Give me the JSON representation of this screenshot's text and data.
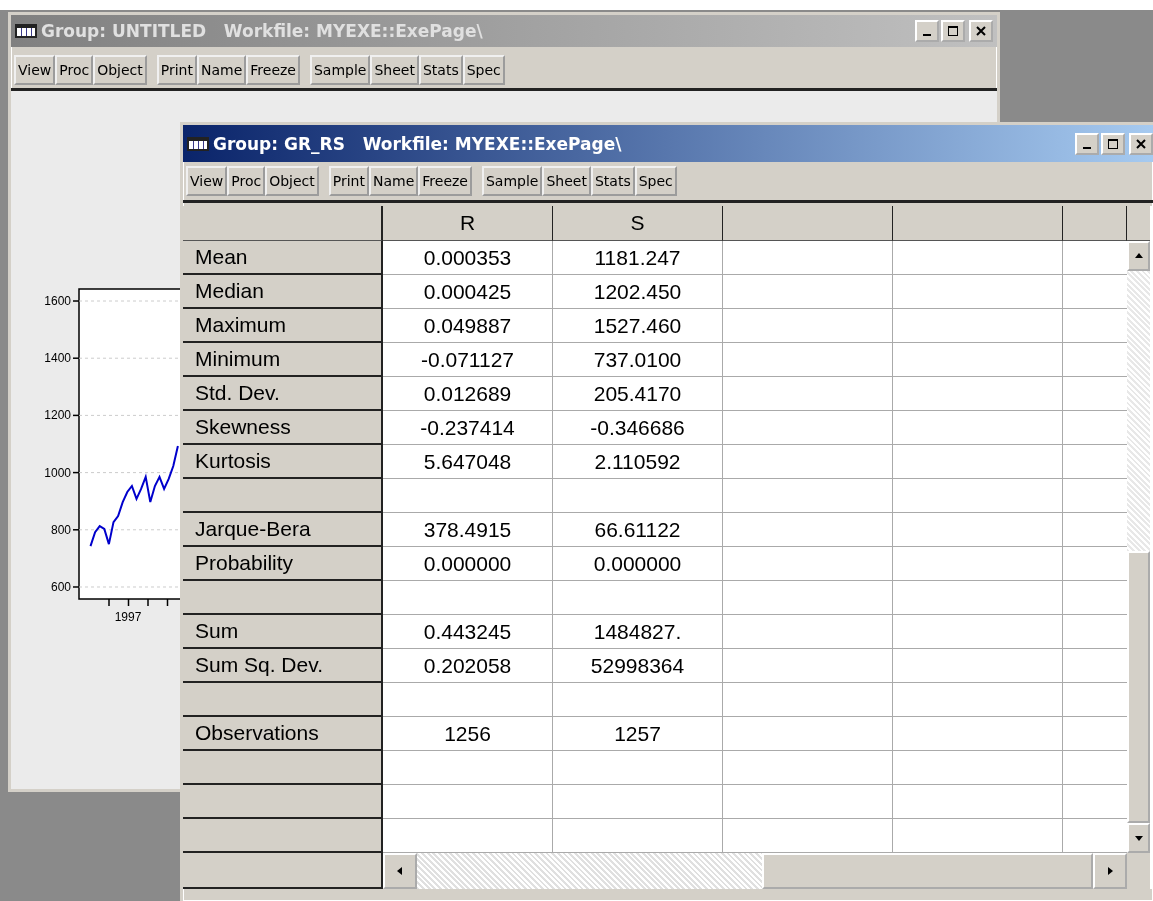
{
  "windows": [
    {
      "kind": "graph",
      "active": false,
      "title": "Group: UNTITLED   Workfile: MYEXE::ExePage\\",
      "toolbar": [
        [
          "View",
          "Proc",
          "Object"
        ],
        [
          "Print",
          "Name",
          "Freeze"
        ],
        [
          "Sample",
          "Sheet",
          "Stats",
          "Spec"
        ]
      ],
      "chart_data": {
        "type": "line",
        "grid": true,
        "series": [
          {
            "color": "#0000cc",
            "values": [
              null,
              null,
              743,
              792,
              813,
              803,
              750,
              827,
              848,
              897,
              932,
              953,
              908,
              943,
              985,
              897,
              953,
              985,
              943,
              978,
              1023,
              1093,
              null,
              null,
              null,
              null,
              null,
              null,
              null,
              null,
              null,
              null,
              null,
              null,
              null,
              null,
              null,
              null,
              null,
              null,
              null,
              null,
              null,
              null,
              null,
              null,
              null,
              null,
              null,
              null,
              null,
              null,
              null,
              null,
              null,
              null,
              null,
              null,
              null,
              null
            ]
          }
        ],
        "ylim": [
          558,
          1642
        ],
        "yticks": [
          {
            "value": 600,
            "label": "600"
          },
          {
            "value": 800,
            "label": "800"
          },
          {
            "value": 1000,
            "label": "1000"
          },
          {
            "value": 1200,
            "label": "1200"
          },
          {
            "value": 1400,
            "label": "1400"
          },
          {
            "value": 1600,
            "label": "1600"
          }
        ],
        "annotations": [
          {
            "text": "1997"
          }
        ]
      }
    },
    {
      "kind": "table",
      "active": true,
      "title": "Group: GR_RS   Workfile: MYEXE::ExePage\\",
      "toolbar": [
        [
          "View",
          "Proc",
          "Object"
        ],
        [
          "Print",
          "Name",
          "Freeze"
        ],
        [
          "Sample",
          "Sheet",
          "Stats",
          "Spec"
        ]
      ],
      "table": {
        "columns": [
          "R",
          "S"
        ],
        "rows": [
          {
            "kind": "stat",
            "label": "Mean",
            "values": [
              "0.000353",
              "1181.247"
            ]
          },
          {
            "kind": "stat",
            "label": "Median",
            "values": [
              "0.000425",
              "1202.450"
            ]
          },
          {
            "kind": "stat",
            "label": "Maximum",
            "values": [
              "0.049887",
              "1527.460"
            ]
          },
          {
            "kind": "stat",
            "label": "Minimum",
            "values": [
              "-0.071127",
              "737.0100"
            ]
          },
          {
            "kind": "stat",
            "label": "Std. Dev.",
            "values": [
              "0.012689",
              "205.4170"
            ]
          },
          {
            "kind": "stat",
            "label": "Skewness",
            "values": [
              "-0.237414",
              "-0.346686"
            ]
          },
          {
            "kind": "stat",
            "label": "Kurtosis",
            "values": [
              "5.647048",
              "2.110592"
            ]
          },
          {
            "kind": "blank"
          },
          {
            "kind": "stat",
            "label": "Jarque-Bera",
            "values": [
              "378.4915",
              "66.61122"
            ]
          },
          {
            "kind": "stat",
            "label": "Probability",
            "values": [
              "0.000000",
              "0.000000"
            ]
          },
          {
            "kind": "blank"
          },
          {
            "kind": "stat",
            "label": "Sum",
            "values": [
              "0.443245",
              "1484827."
            ]
          },
          {
            "kind": "stat",
            "label": "Sum Sq. Dev.",
            "values": [
              "0.202058",
              "52998364"
            ]
          },
          {
            "kind": "blank"
          },
          {
            "kind": "stat",
            "label": "Observations",
            "values": [
              "1256",
              "1257"
            ]
          },
          {
            "kind": "blank"
          },
          {
            "kind": "blank"
          },
          {
            "kind": "blank"
          }
        ]
      }
    }
  ]
}
